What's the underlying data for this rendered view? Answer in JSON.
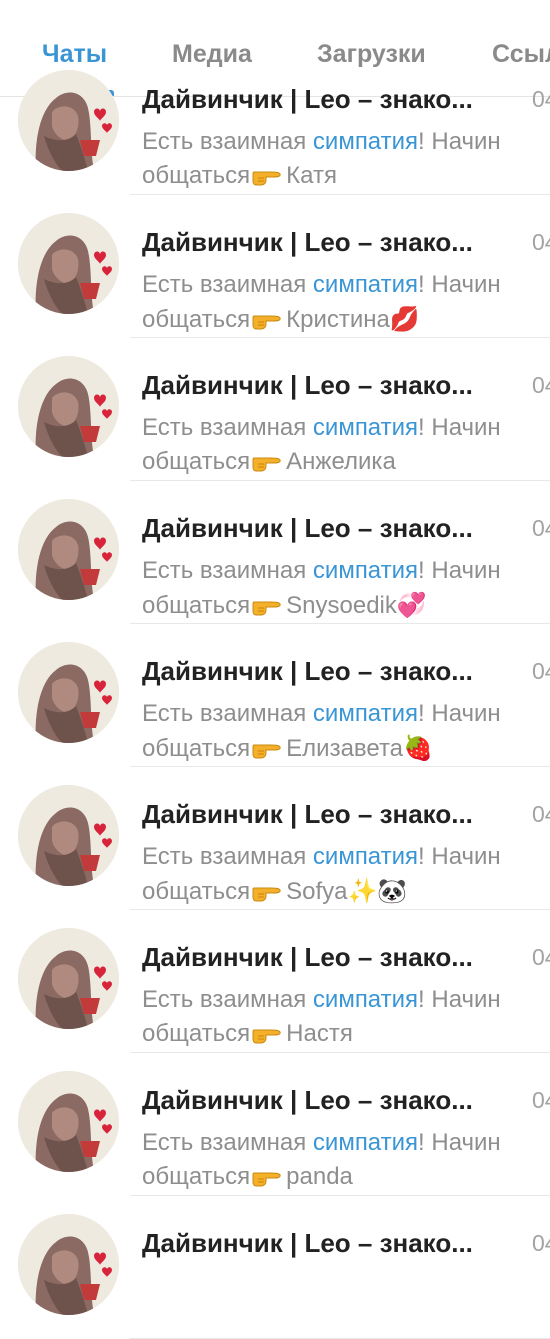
{
  "tabs": [
    {
      "label": "Чаты",
      "active": true
    },
    {
      "label": "Медиа",
      "active": false
    },
    {
      "label": "Загрузки",
      "active": false
    },
    {
      "label": "Ссыл",
      "active": false
    }
  ],
  "chats": [
    {
      "title": "Дайвинчик | Leo – знако...",
      "time": "04",
      "preview_before": "Есть взаимная ",
      "preview_highlight": "симпатия",
      "preview_after": "! Начин",
      "line2_prefix": "общаться",
      "name": "Катя",
      "emoji": ""
    },
    {
      "title": "Дайвинчик | Leo – знако...",
      "time": "04",
      "preview_before": "Есть взаимная ",
      "preview_highlight": "симпатия",
      "preview_after": "! Начин",
      "line2_prefix": "общаться",
      "name": "Кристина",
      "emoji": "💋"
    },
    {
      "title": "Дайвинчик | Leo – знако...",
      "time": "04",
      "preview_before": "Есть взаимная ",
      "preview_highlight": "симпатия",
      "preview_after": "! Начин",
      "line2_prefix": "общаться",
      "name": "Анжелика",
      "emoji": ""
    },
    {
      "title": "Дайвинчик | Leo – знако...",
      "time": "04",
      "preview_before": "Есть взаимная ",
      "preview_highlight": "симпатия",
      "preview_after": "! Начин",
      "line2_prefix": "общаться",
      "name": "Snysoedik",
      "emoji": "💞"
    },
    {
      "title": "Дайвинчик | Leo – знако...",
      "time": "04",
      "preview_before": "Есть взаимная ",
      "preview_highlight": "симпатия",
      "preview_after": "! Начин",
      "line2_prefix": "общаться",
      "name": "Елизавета",
      "emoji": "🍓"
    },
    {
      "title": "Дайвинчик | Leo – знако...",
      "time": "04",
      "preview_before": "Есть взаимная ",
      "preview_highlight": "симпатия",
      "preview_after": "! Начин",
      "line2_prefix": "общаться",
      "name": "Sofya",
      "emoji": "✨🐼"
    },
    {
      "title": "Дайвинчик | Leo – знако...",
      "time": "04",
      "preview_before": "Есть взаимная ",
      "preview_highlight": "симпатия",
      "preview_after": "! Начин",
      "line2_prefix": "общаться",
      "name": "Настя",
      "emoji": ""
    },
    {
      "title": "Дайвинчик | Leo – знако...",
      "time": "04",
      "preview_before": "Есть взаимная ",
      "preview_highlight": "симпатия",
      "preview_after": "! Начин",
      "line2_prefix": "общаться",
      "name": "panda",
      "emoji": ""
    },
    {
      "title": "Дайвинчик | Leo – знако...",
      "time": "04",
      "preview_before": "",
      "preview_highlight": "",
      "preview_after": "",
      "line2_prefix": "",
      "name": "",
      "emoji": ""
    }
  ],
  "icons": {
    "avatar": "leonardo-portrait-avatar",
    "pointer": "pointing-right-hand-icon"
  },
  "colors": {
    "accent": "#3a95d5",
    "text": "#222222",
    "muted": "#8e8e8e"
  }
}
